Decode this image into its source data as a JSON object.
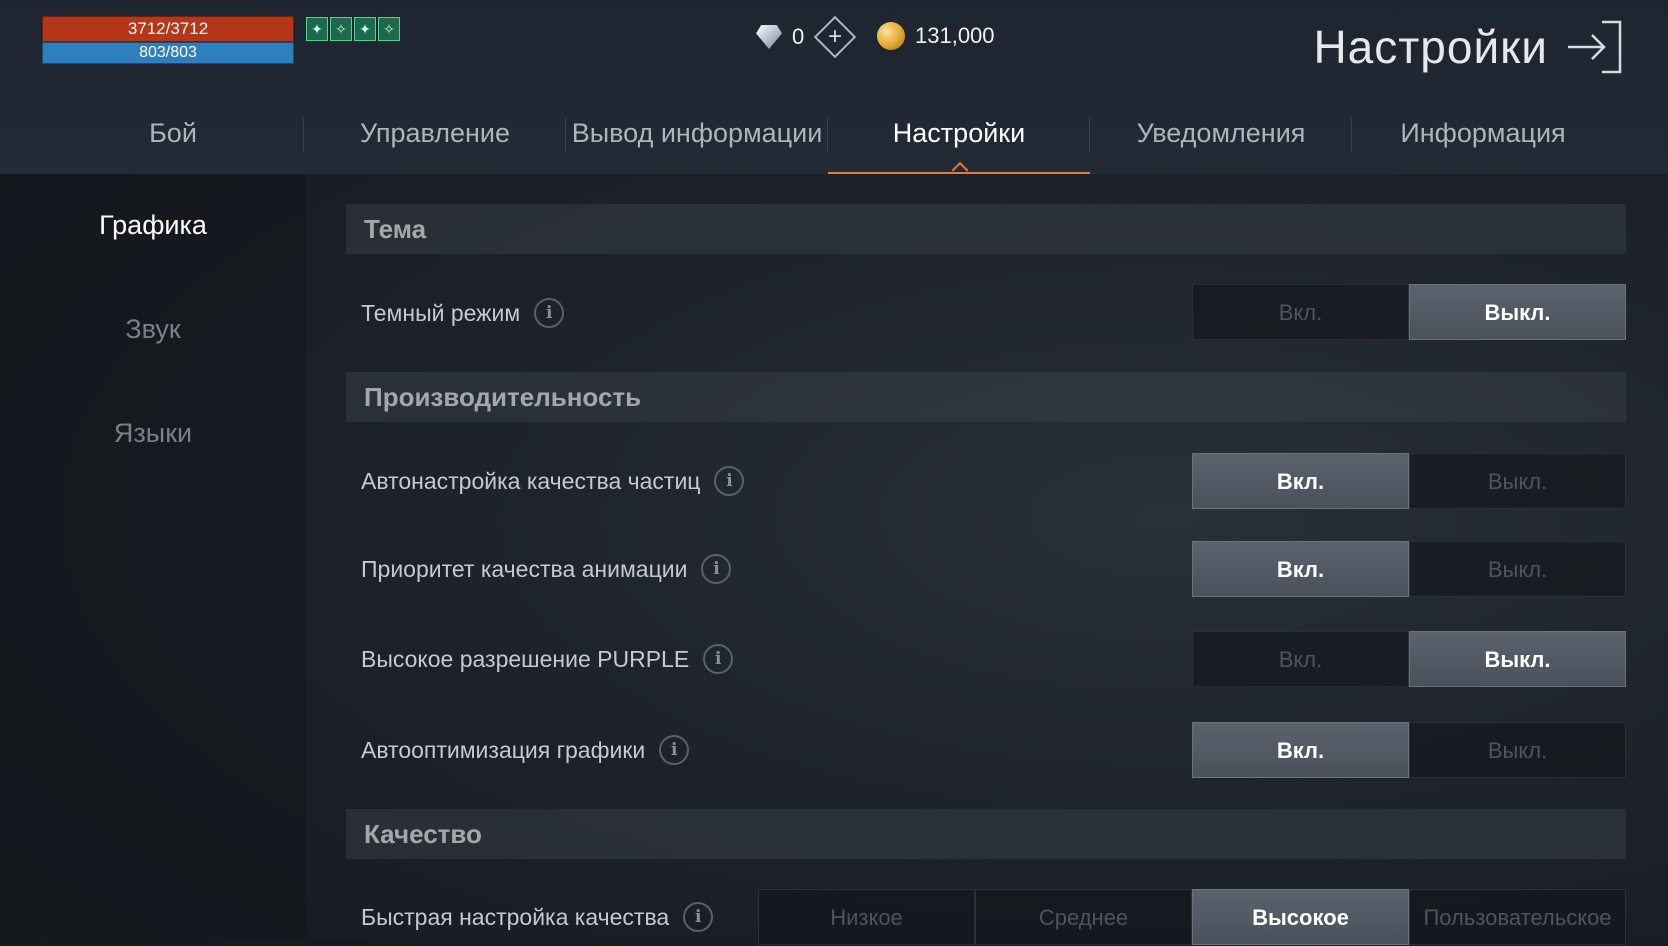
{
  "hud": {
    "hp": "3712/3712",
    "mp": "803/803",
    "buffs": [
      "✦",
      "✧",
      "✦",
      "✧"
    ]
  },
  "currency": {
    "gems": "0",
    "gold": "131,000"
  },
  "page_title": "Настройки",
  "tabs": [
    {
      "label": "Бой"
    },
    {
      "label": "Управление"
    },
    {
      "label": "Вывод информации"
    },
    {
      "label": "Настройки",
      "active": true
    },
    {
      "label": "Уведомления"
    },
    {
      "label": "Информация"
    }
  ],
  "sidebar": {
    "items": [
      {
        "label": "Графика",
        "active": true
      },
      {
        "label": "Звук"
      },
      {
        "label": "Языки"
      }
    ]
  },
  "sections": {
    "theme": "Тема",
    "performance": "Производительность",
    "quality": "Качество"
  },
  "options": {
    "on": "Вкл.",
    "off": "Выкл."
  },
  "settings": [
    {
      "label": "Темный режим",
      "value": "Выкл."
    },
    {
      "label": "Автонастройка качества частиц",
      "value": "Вкл."
    },
    {
      "label": "Приоритет качества анимации",
      "value": "Вкл."
    },
    {
      "label": "Высокое разрешение PURPLE",
      "value": "Выкл."
    },
    {
      "label": "Автооптимизация графики",
      "value": "Вкл."
    }
  ],
  "quality_preset": {
    "label": "Быстрая настройка качества",
    "options": [
      "Низкое",
      "Среднее",
      "Высокое",
      "Пользовательское"
    ],
    "selected": "Высокое"
  },
  "colors": {
    "accent": "#e07b3a",
    "hp_bar": "#b6361a",
    "mp_bar": "#2f7fbf"
  }
}
